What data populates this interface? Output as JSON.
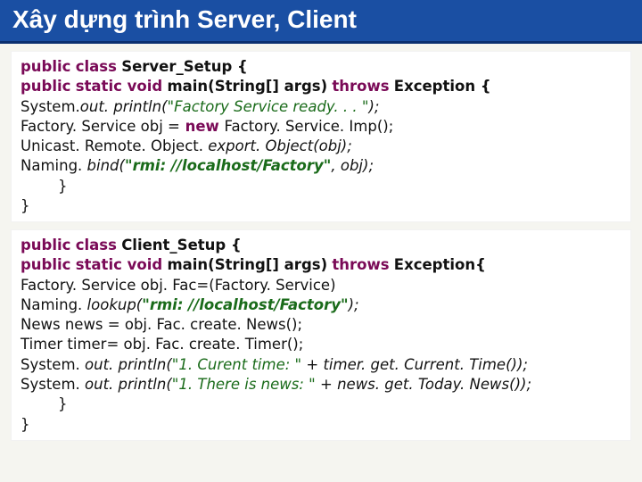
{
  "title": "Xây dựng trình Server, Client",
  "server": {
    "l1_public": "public",
    "l1_class": "class",
    "l1_name": "Server_Setup {",
    "l2_public": "public",
    "l2_sv": "static void",
    "l2_main": "main(String[] args)",
    "l2_throws": "throws",
    "l2_exc": "Exception {",
    "l3a": "System.",
    "l3b": "out. println(",
    "l3c": "\"Factory Service ready. . . \"",
    "l3d": ");",
    "l4a": "Factory. Service obj =",
    "l4_new": " new ",
    "l4b": "Factory. Service. Imp();",
    "l5": "Unicast. Remote. Object. ",
    "l5m": "export. Object(obj);",
    "l6a": "Naming. ",
    "l6m": "bind(",
    "l6s": "\"rmi: //localhost/Factory\"",
    "l6b": ", obj);",
    "l7": "        }",
    "l8": "}"
  },
  "client": {
    "l1_public": "public",
    "l1_class": "class",
    "l1_name": "Client_Setup {",
    "l2_public": "public",
    "l2_sv": "static void",
    "l2_main": "main(String[] args)",
    "l2_throws": "throws",
    "l2_exc": "Exception{",
    "l3": "Factory. Service obj. Fac=(Factory. Service)",
    "l4a": "Naming. ",
    "l4m": "lookup(",
    "l4s": "\"rmi: //localhost/Factory\"",
    "l4b": ");",
    "l5": "News news = obj. Fac. create. News();",
    "l6": "Timer timer= obj. Fac. create. Timer();",
    "l7a": "System.",
    "l7b": " out. println(",
    "l7s": "\"1. Curent time: \"",
    "l7c": " + timer. get. Current. Time());",
    "l8a": "System.",
    "l8b": " out. println(",
    "l8s": "\"1. There is news: \"",
    "l8c": " + news. get. Today. News());",
    "l9": "        }",
    "l10": "}"
  }
}
